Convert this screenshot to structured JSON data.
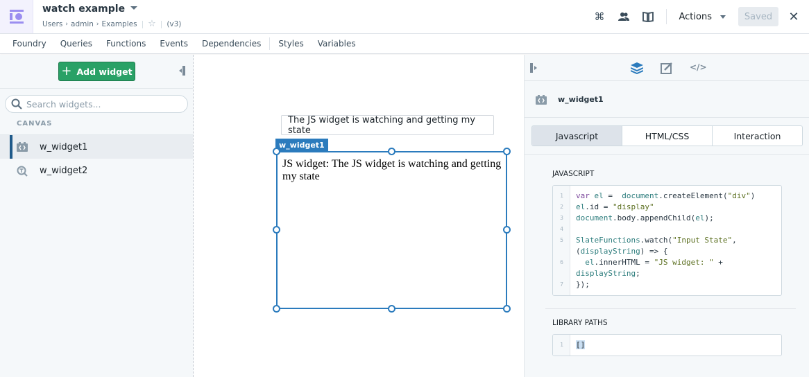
{
  "header": {
    "title": "watch example",
    "breadcrumbs": [
      "Users",
      "admin",
      "Examples"
    ],
    "version": "(v3)",
    "actions_label": "Actions",
    "saved_label": "Saved",
    "icons": [
      "command-icon",
      "users-icon",
      "book-icon",
      "close-icon"
    ]
  },
  "menu": {
    "items": [
      "Foundry",
      "Queries",
      "Functions",
      "Events",
      "Dependencies",
      "Styles",
      "Variables"
    ]
  },
  "left_panel": {
    "add_widget_label": "Add widget",
    "search_placeholder": "Search widgets...",
    "section_label": "CANVAS",
    "widgets": [
      {
        "name": "w_widget1",
        "icon": "code-widget-icon",
        "active": true
      },
      {
        "name": "w_widget2",
        "icon": "text-input-widget-icon",
        "active": false
      }
    ]
  },
  "canvas": {
    "text_input_value": "The JS widget is watching and getting my state",
    "selected_widget_tag": "w_widget1",
    "widget_output": "JS widget: The JS widget is watching and getting my state"
  },
  "right_panel": {
    "widget_name": "w_widget1",
    "tabs": [
      {
        "label": "Javascript",
        "active": true
      },
      {
        "label": "HTML/CSS",
        "active": false
      },
      {
        "label": "Interaction",
        "active": false
      }
    ],
    "javascript_label": "JAVASCRIPT",
    "library_paths_label": "LIBRARY PATHS",
    "code_line_numbers": [
      "1",
      "2",
      "3",
      "4",
      "5",
      "",
      "6",
      "",
      "7"
    ],
    "library_line_numbers": [
      "1"
    ],
    "library_value": "[]",
    "colors": {
      "accent": "#2b7bbd",
      "add_button": "#29a166",
      "logo": "#9b8ef0"
    }
  }
}
